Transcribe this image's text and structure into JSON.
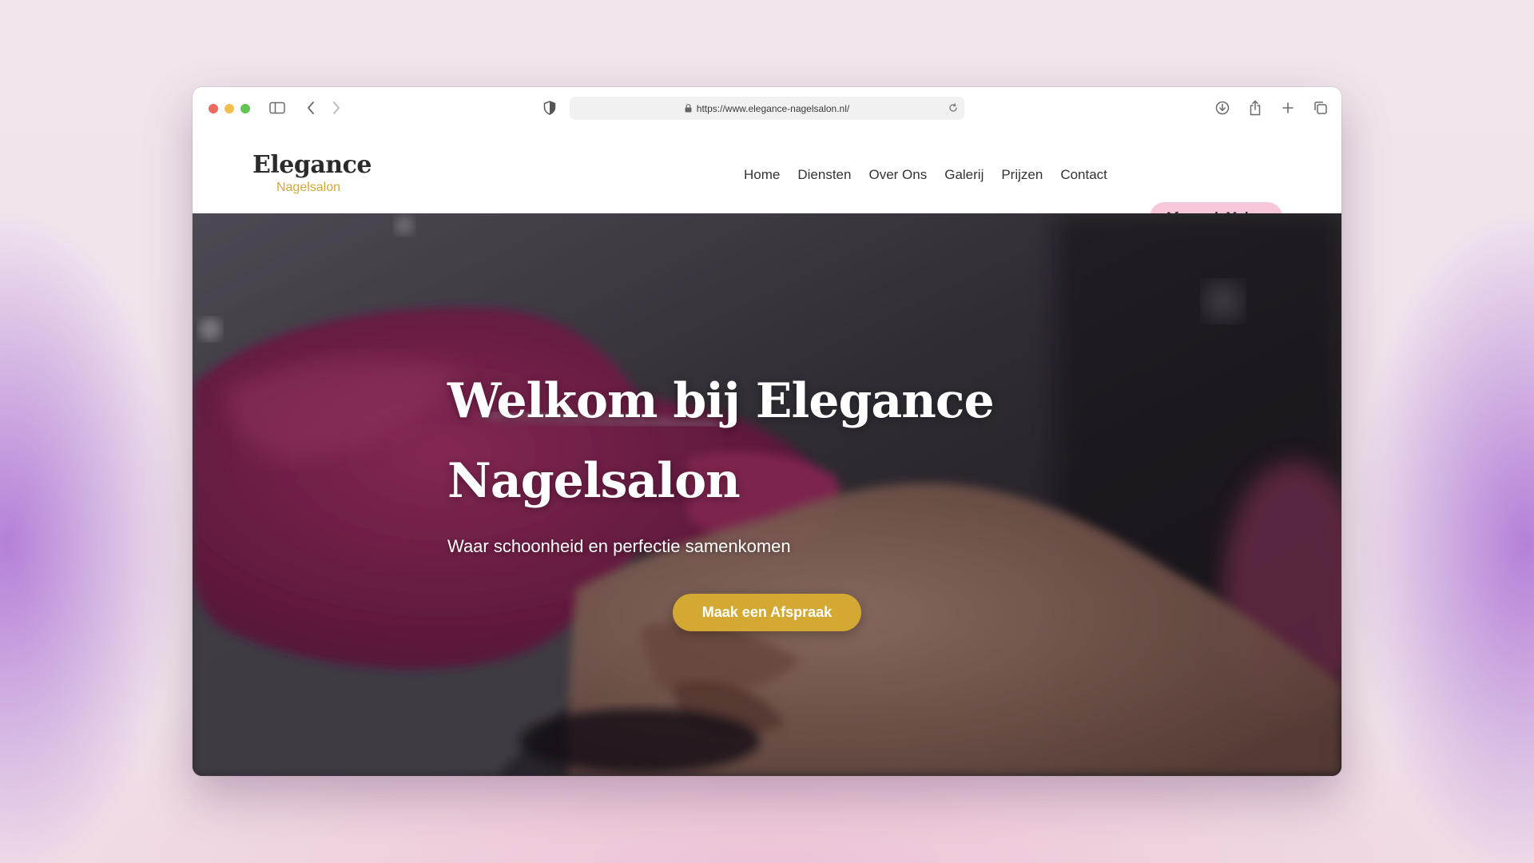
{
  "browser": {
    "url": "https://www.elegance-nagelsalon.nl/",
    "traffic_colors": {
      "close": "#ec6a5e",
      "minimize": "#f4bf4f",
      "maximize": "#61c554"
    },
    "icons": [
      "sidebar-icon",
      "back-icon",
      "forward-icon",
      "privacy-shield-icon",
      "lock-icon",
      "reload-icon",
      "download-icon",
      "share-icon",
      "new-tab-icon",
      "tab-overview-icon"
    ]
  },
  "site": {
    "logo": {
      "title": "Elegance",
      "subtitle": "Nagelsalon"
    },
    "nav": {
      "links": [
        "Home",
        "Diensten",
        "Over Ons",
        "Galerij",
        "Prijzen",
        "Contact"
      ],
      "cta": "Afspraak Maken"
    },
    "hero": {
      "title": "Welkom bij Elegance Nagelsalon",
      "subtitle": "Waar schoonheid en perfectie samenkomen",
      "cta": "Maak een Afspraak"
    },
    "colors": {
      "accent_gold": "#d3a933",
      "accent_pink": "#f6c6da",
      "text_dark": "#2b2b2b"
    }
  }
}
